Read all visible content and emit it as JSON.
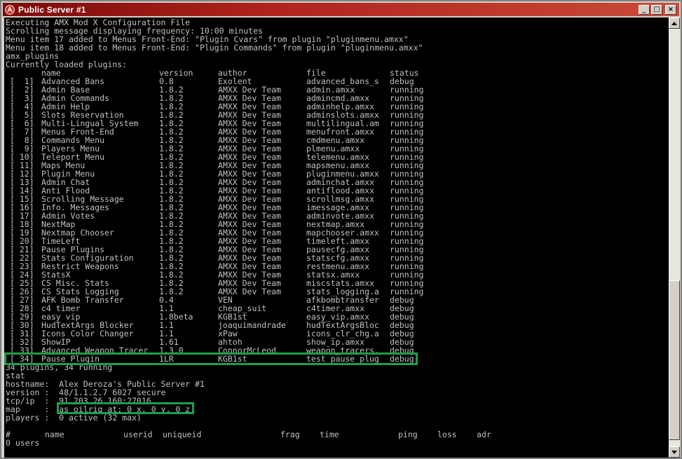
{
  "window": {
    "title": "Public Server #1",
    "buttons": {
      "minimize": "_",
      "maximize": "□",
      "close": "×"
    }
  },
  "console": {
    "pre_lines": [
      "Executing AMX Mod X Configuration File",
      "Scrolling message displaying frequency: 10:00 minutes",
      "Menu item 17 added to Menus Front-End: \"Plugin Cvars\" from plugin \"pluginmenu.amxx\"",
      "Menu item 18 added to Menus Front-End: \"Plugin Commands\" from plugin \"pluginmenu.amxx\"",
      "amx_plugins",
      "Currently loaded plugins:"
    ],
    "plugin_headers": {
      "name": "name",
      "version": "version",
      "author": "author",
      "file": "file",
      "status": "status"
    },
    "plugins": [
      {
        "num": "[  1]",
        "name": "Advanced Bans",
        "version": "0.8",
        "author": "Exolent",
        "file": "advanced_bans_s",
        "status": "debug"
      },
      {
        "num": "[  2]",
        "name": "Admin Base",
        "version": "1.8.2",
        "author": "AMXX Dev Team",
        "file": "admin.amxx",
        "status": "running"
      },
      {
        "num": "[  3]",
        "name": "Admin Commands",
        "version": "1.8.2",
        "author": "AMXX Dev Team",
        "file": "admincmd.amxx",
        "status": "running"
      },
      {
        "num": "[  4]",
        "name": "Admin Help",
        "version": "1.8.2",
        "author": "AMXX Dev Team",
        "file": "adminhelp.amxx",
        "status": "running"
      },
      {
        "num": "[  5]",
        "name": "Slots Reservation",
        "version": "1.8.2",
        "author": "AMXX Dev Team",
        "file": "adminslots.amxx",
        "status": "running"
      },
      {
        "num": "[  6]",
        "name": "Multi-Lingual System",
        "version": "1.8.2",
        "author": "AMXX Dev Team",
        "file": "multilingual.am",
        "status": "running"
      },
      {
        "num": "[  7]",
        "name": "Menus Front-End",
        "version": "1.8.2",
        "author": "AMXX Dev Team",
        "file": "menufront.amxx",
        "status": "running"
      },
      {
        "num": "[  8]",
        "name": "Commands Menu",
        "version": "1.8.2",
        "author": "AMXX Dev Team",
        "file": "cmdmenu.amxx",
        "status": "running"
      },
      {
        "num": "[  9]",
        "name": "Players Menu",
        "version": "1.8.2",
        "author": "AMXX Dev Team",
        "file": "plmenu.amxx",
        "status": "running"
      },
      {
        "num": "[ 10]",
        "name": "Teleport Menu",
        "version": "1.8.2",
        "author": "AMXX Dev Team",
        "file": "telemenu.amxx",
        "status": "running"
      },
      {
        "num": "[ 11]",
        "name": "Maps Menu",
        "version": "1.8.2",
        "author": "AMXX Dev Team",
        "file": "mapsmenu.amxx",
        "status": "running"
      },
      {
        "num": "[ 12]",
        "name": "Plugin Menu",
        "version": "1.8.2",
        "author": "AMXX Dev Team",
        "file": "pluginmenu.amxx",
        "status": "running"
      },
      {
        "num": "[ 13]",
        "name": "Admin Chat",
        "version": "1.8.2",
        "author": "AMXX Dev Team",
        "file": "adminchat.amxx",
        "status": "running"
      },
      {
        "num": "[ 14]",
        "name": "Anti Flood",
        "version": "1.8.2",
        "author": "AMXX Dev Team",
        "file": "antiflood.amxx",
        "status": "running"
      },
      {
        "num": "[ 15]",
        "name": "Scrolling Message",
        "version": "1.8.2",
        "author": "AMXX Dev Team",
        "file": "scrollmsg.amxx",
        "status": "running"
      },
      {
        "num": "[ 16]",
        "name": "Info. Messages",
        "version": "1.8.2",
        "author": "AMXX Dev Team",
        "file": "imessage.amxx",
        "status": "running"
      },
      {
        "num": "[ 17]",
        "name": "Admin Votes",
        "version": "1.8.2",
        "author": "AMXX Dev Team",
        "file": "adminvote.amxx",
        "status": "running"
      },
      {
        "num": "[ 18]",
        "name": "NextMap",
        "version": "1.8.2",
        "author": "AMXX Dev Team",
        "file": "nextmap.amxx",
        "status": "running"
      },
      {
        "num": "[ 19]",
        "name": "Nextmap Chooser",
        "version": "1.8.2",
        "author": "AMXX Dev Team",
        "file": "mapchooser.amxx",
        "status": "running"
      },
      {
        "num": "[ 20]",
        "name": "TimeLeft",
        "version": "1.8.2",
        "author": "AMXX Dev Team",
        "file": "timeleft.amxx",
        "status": "running"
      },
      {
        "num": "[ 21]",
        "name": "Pause Plugins",
        "version": "1.8.2",
        "author": "AMXX Dev Team",
        "file": "pausecfg.amxx",
        "status": "running"
      },
      {
        "num": "[ 22]",
        "name": "Stats Configuration",
        "version": "1.8.2",
        "author": "AMXX Dev Team",
        "file": "statscfg.amxx",
        "status": "running"
      },
      {
        "num": "[ 23]",
        "name": "Restrict Weapons",
        "version": "1.8.2",
        "author": "AMXX Dev Team",
        "file": "restmenu.amxx",
        "status": "running"
      },
      {
        "num": "[ 24]",
        "name": "StatsX",
        "version": "1.8.2",
        "author": "AMXX Dev Team",
        "file": "statsx.amxx",
        "status": "running"
      },
      {
        "num": "[ 25]",
        "name": "CS Misc. Stats",
        "version": "1.8.2",
        "author": "AMXX Dev Team",
        "file": "miscstats.amxx",
        "status": "running"
      },
      {
        "num": "[ 26]",
        "name": "CS Stats Logging",
        "version": "1.8.2",
        "author": "AMXX Dev Team",
        "file": "stats_logging.a",
        "status": "running"
      },
      {
        "num": "[ 27]",
        "name": "AFK Bomb Transfer",
        "version": "0.4",
        "author": "VEN",
        "file": "afkbombtransfer",
        "status": "debug"
      },
      {
        "num": "[ 28]",
        "name": "c4 timer",
        "version": "1.1",
        "author": "cheap_suit",
        "file": "c4timer.amxx",
        "status": "debug"
      },
      {
        "num": "[ 29]",
        "name": "easy vip",
        "version": "1.8beta",
        "author": "KGB1st",
        "file": "easy_vip.amxx",
        "status": "debug"
      },
      {
        "num": "[ 30]",
        "name": "HudTextArgs Blocker",
        "version": "1.1",
        "author": "joaquimandrade",
        "file": "hudTextArgsBloc",
        "status": "debug"
      },
      {
        "num": "[ 31]",
        "name": "Icons Color Changer",
        "version": "1.1",
        "author": "xPaw",
        "file": "icons_clr_chg.a",
        "status": "debug"
      },
      {
        "num": "[ 32]",
        "name": "ShowIP",
        "version": "1.61",
        "author": "ahtoh",
        "file": "show_ip.amxx",
        "status": "debug"
      },
      {
        "num": "[ 33]",
        "name": "Advanced Weapon Tracer",
        "version": "1.3.0",
        "author": "ConnorMcLeod",
        "file": "weapon_tracers.",
        "status": "debug"
      },
      {
        "num": "[ 34]",
        "name": "Pause Plugin",
        "version": "1LR",
        "author": "KGB1st",
        "file": "test_pause_plug",
        "status": "debug"
      }
    ],
    "post_lines": [
      "34 plugins, 34 running",
      "stat",
      "hostname:  Alex Deroza's Public Server #1",
      "version :  48/1.1.2.7 6027 secure",
      "tcp/ip  :  91.203.26.160:27016",
      "map     :  as_oilrig at: 0 x, 0 y, 0 z",
      "players :  0 active (32 max)",
      ""
    ],
    "users_headers": {
      "hash": "#",
      "name": "name",
      "userid": "userid",
      "uniqueid": "uniqueid",
      "frag": "frag",
      "time": "time",
      "ping": "ping",
      "loss": "loss",
      "adr": "adr"
    },
    "users_count": "0 users"
  },
  "colors": {
    "console_bg": "#000000",
    "console_text": "#c0c0c0",
    "highlight": "#1e9e4a",
    "titlebar": "#9a1c14"
  }
}
